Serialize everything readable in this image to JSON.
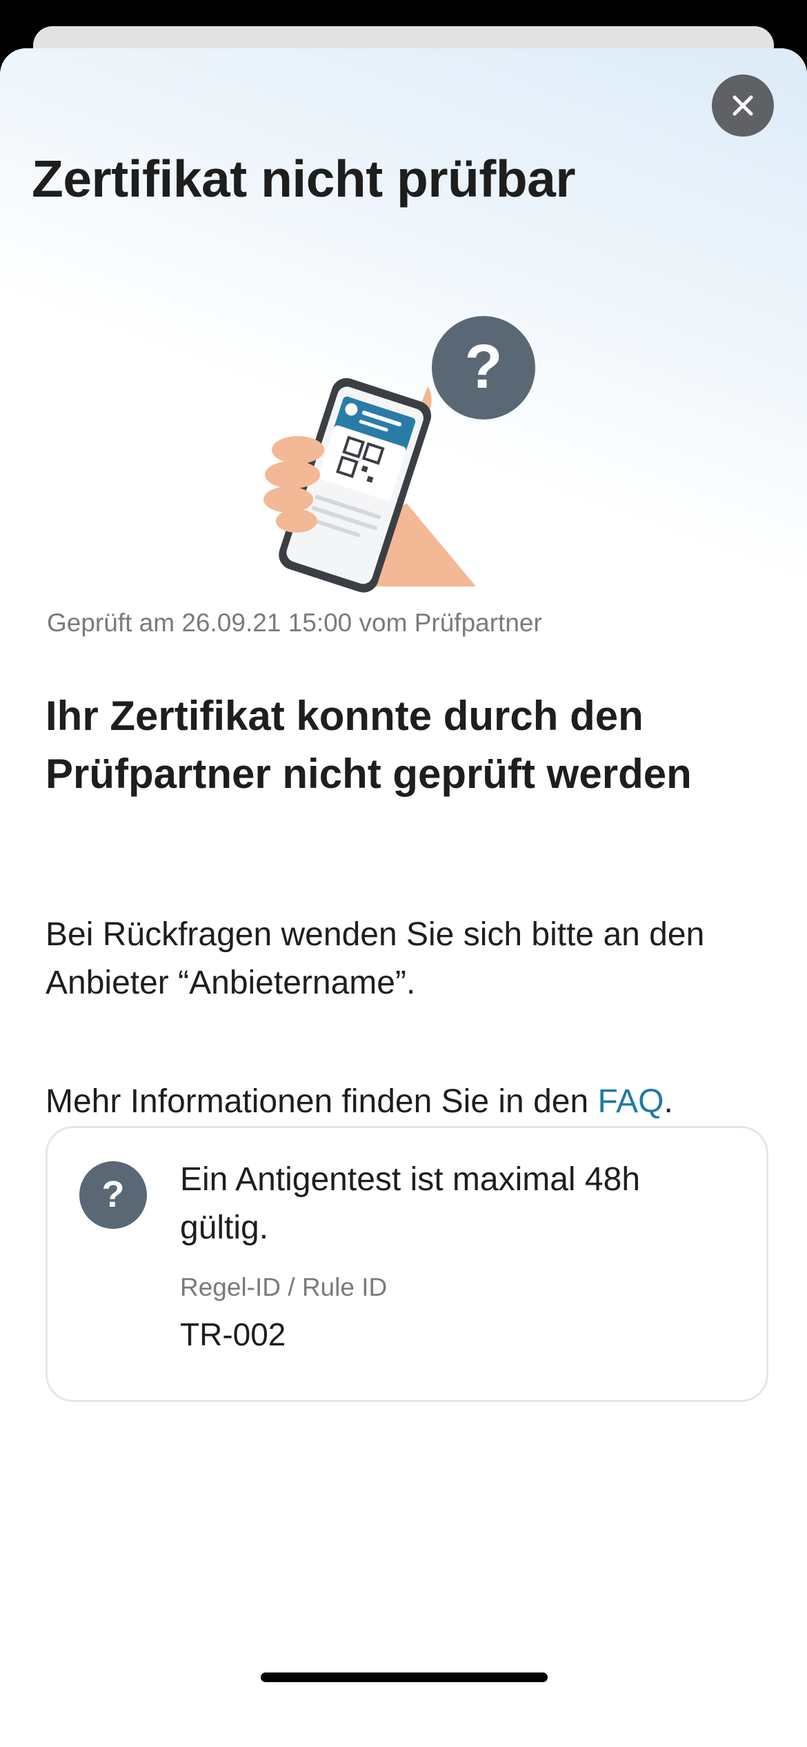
{
  "sheet": {
    "title": "Zertifikat nicht prüfbar",
    "close_icon": "close-icon"
  },
  "illustration": {
    "icon": "phone-with-qr-code-and-question-mark"
  },
  "result": {
    "checked_line": "Geprüft am 26.09.21 15:00 vom Prüfpartner",
    "headline": "Ihr Zertifikat konnte durch den Prüfpartner nicht geprüft werden",
    "contact_text": "Bei Rückfragen wenden Sie sich bitte an den Anbieter “Anbietername”.",
    "faq_prefix": "Mehr Informationen finden Sie in den ",
    "faq_link": "FAQ",
    "faq_suffix": "."
  },
  "rule": {
    "icon": "question-icon",
    "text": "Ein Antigentest ist maximal 48h gültig.",
    "id_label": "Regel-ID / Rule ID",
    "id_value": "TR-002"
  },
  "colors": {
    "accent_link": "#1f7aa5",
    "icon_gray": "#5a6775",
    "close_button": "#5f6164"
  }
}
